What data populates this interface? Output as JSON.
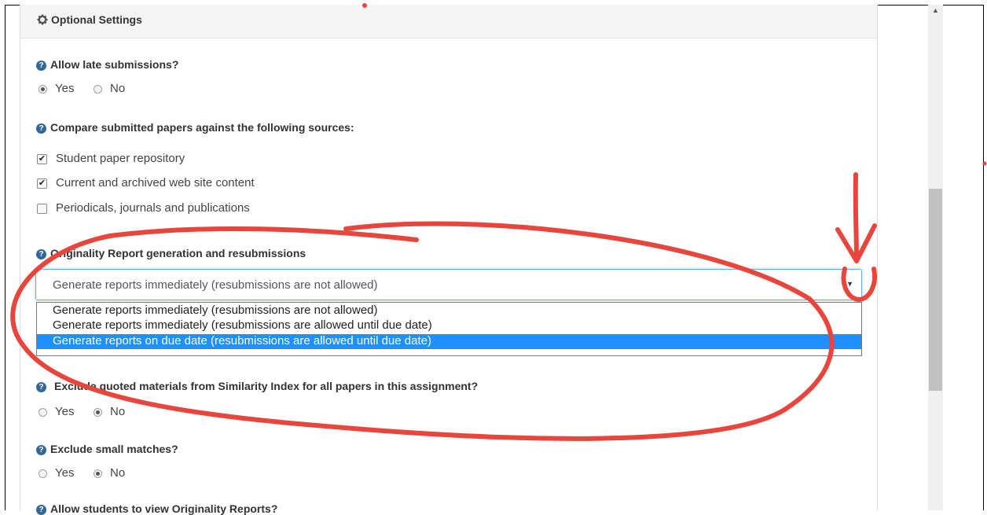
{
  "optional_settings": {
    "title": "Optional Settings",
    "icon": "gear-icon"
  },
  "late_submissions": {
    "question": "Allow late submissions?",
    "options": [
      {
        "label": "Yes",
        "checked": true
      },
      {
        "label": "No",
        "checked": false
      }
    ]
  },
  "compare_sources": {
    "question": "Compare submitted papers against the following sources:",
    "items": [
      {
        "label": "Student paper repository",
        "checked": true
      },
      {
        "label": "Current and archived web site content",
        "checked": true
      },
      {
        "label": "Periodicals, journals and publications",
        "checked": false
      }
    ]
  },
  "originality_report": {
    "question": "Originality Report generation and resubmissions",
    "selected": "Generate reports immediately (resubmissions are not allowed)",
    "options": [
      "Generate reports immediately (resubmissions are not allowed)",
      "Generate reports immediately (resubmissions are allowed until due date)",
      "Generate reports on due date (resubmissions are allowed until due date)"
    ],
    "highlighted_option": "Generate reports on due date (resubmissions are allowed until due date)"
  },
  "exclude_quoted": {
    "question": "Exclude quoted materials from Similarity Index for all papers in this assignment?",
    "options": [
      {
        "label": "Yes",
        "checked": false
      },
      {
        "label": "No",
        "checked": true
      }
    ]
  },
  "exclude_small": {
    "question": "Exclude small matches?",
    "options": [
      {
        "label": "Yes",
        "checked": false
      },
      {
        "label": "No",
        "checked": true
      }
    ]
  },
  "view_reports": {
    "question": "Allow students to view Originality Reports?"
  },
  "colors": {
    "annotation": "#e8453c",
    "highlight": "#1e90ff",
    "help_icon": "#336699"
  }
}
